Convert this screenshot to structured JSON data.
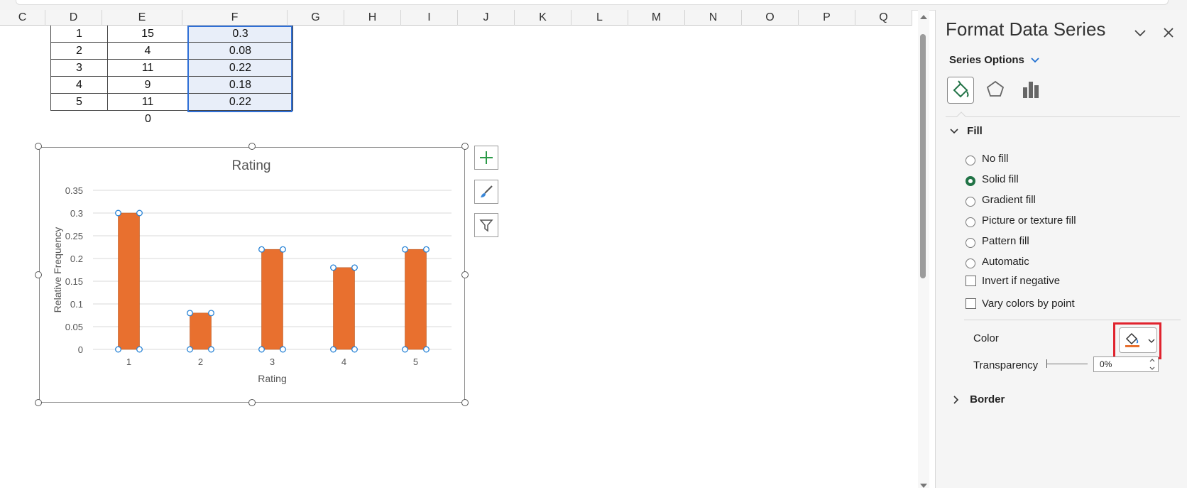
{
  "sheet": {
    "columns": [
      "C",
      "D",
      "E",
      "F",
      "G",
      "H",
      "I",
      "J",
      "K",
      "L",
      "M",
      "N",
      "O",
      "P",
      "Q"
    ],
    "rows": [
      {
        "d": "1",
        "e": "15",
        "f": "0.3"
      },
      {
        "d": "2",
        "e": "4",
        "f": "0.08"
      },
      {
        "d": "3",
        "e": "11",
        "f": "0.22"
      },
      {
        "d": "4",
        "e": "9",
        "f": "0.18"
      },
      {
        "d": "5",
        "e": "11",
        "f": "0.22"
      }
    ],
    "total_e": "0"
  },
  "chart_data": {
    "type": "bar",
    "title": "Rating",
    "xlabel": "Rating",
    "ylabel": "Relative Frequency",
    "categories": [
      "1",
      "2",
      "3",
      "4",
      "5"
    ],
    "values": [
      0.3,
      0.08,
      0.22,
      0.18,
      0.22
    ],
    "ylim": [
      0,
      0.35
    ],
    "yticks": [
      "0",
      "0.05",
      "0.1",
      "0.15",
      "0.2",
      "0.25",
      "0.3",
      "0.35"
    ],
    "bar_color": "#E8702F",
    "grid": true
  },
  "chart_tools": {
    "add_label": "+"
  },
  "pane": {
    "title": "Format Data Series",
    "series_options": "Series Options",
    "fill_section": "Fill",
    "fill_options": [
      "No fill",
      "Solid fill",
      "Gradient fill",
      "Picture or texture fill",
      "Pattern fill",
      "Automatic"
    ],
    "selected_fill": "Solid fill",
    "invert_label": "Invert if negative",
    "vary_label": "Vary colors by point",
    "color_label": "Color",
    "transparency_label": "Transparency",
    "transparency_value": "0%",
    "border_section": "Border",
    "accent_color": "#217346",
    "highlight_color": "#E0232E"
  }
}
